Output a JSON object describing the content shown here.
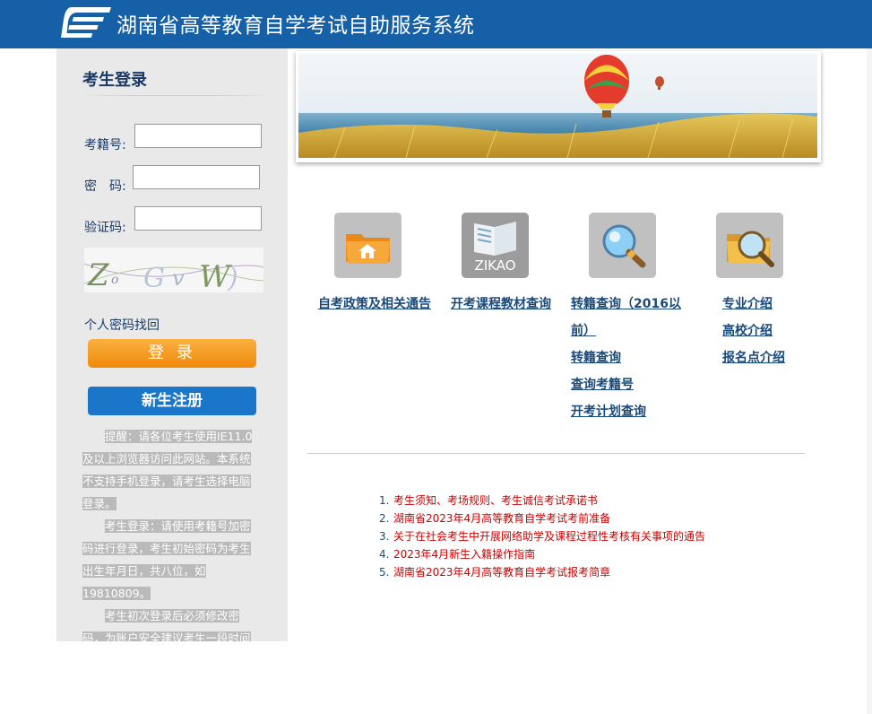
{
  "header": {
    "title": "湖南省高等教育自学考试自助服务系统"
  },
  "login": {
    "title": "考生登录",
    "exam_no_label": "考籍号:",
    "password_label": "密　码:",
    "captcha_label": "验证码:",
    "captcha_text": "ZoGvW",
    "recover_link": "个人密码找回",
    "login_button": "登 录",
    "register_button": "新生注册",
    "notices": [
      "提醒：请各位考生使用IE11.0及以上浏览器访问此网站。本系统不支持手机登录，请考生选择电脑登录。",
      "考生登录：请使用考籍号加密码进行登录，考生初始密码为考生出生年月日，共八位，如19810809。",
      "考生初次登录后必须修改密码，为账户安全建议考生一段时间修改密码，忘记密码点上面个人密码找回。"
    ]
  },
  "quick_links": {
    "col1": {
      "icon": "folder-home-icon",
      "links": [
        "自考政策及相关通告"
      ]
    },
    "col2": {
      "icon": "book-icon",
      "icon_text": "ZIKAO",
      "links": [
        "开考课程教材查询"
      ]
    },
    "col3": {
      "icon": "magnifier-icon",
      "links": [
        "转籍查询（2016以",
        "前）",
        "转籍查询",
        "查询考籍号",
        "开考计划查询"
      ]
    },
    "col4": {
      "icon": "folder-search-icon",
      "links": [
        "专业介绍",
        "高校介绍",
        "报名点介绍"
      ]
    }
  },
  "news": [
    {
      "num": "1.",
      "text": "考生须知、考场规则、考生诚信考试承诺书"
    },
    {
      "num": "2.",
      "text": "湖南省2023年4月高等教育自学考试考前准备"
    },
    {
      "num": "3.",
      "text": "关于在社会考生中开展网络助学及课程过程性考核有关事项的通告"
    },
    {
      "num": "4.",
      "text": "2023年4月新生入籍操作指南"
    },
    {
      "num": "5.",
      "text": "湖南省2023年4月高等教育自学考试报考简章"
    }
  ],
  "colors": {
    "header_bg": "#1660a8",
    "sidebar_bg": "#e9e9e9",
    "login_orange": "#ef8a0c",
    "register_blue": "#1976c8",
    "news_red": "#cc0000",
    "link_blue": "#1a4a7a"
  }
}
